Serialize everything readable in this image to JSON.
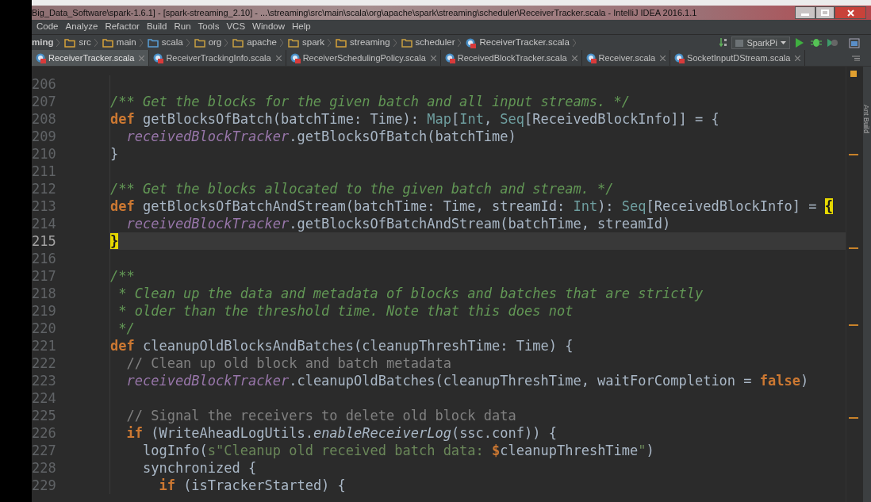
{
  "window": {
    "title": "Big_Data_Software\\spark-1.6.1] - [spark-streaming_2.10] - ...\\streaming\\src\\main\\scala\\org\\apache\\spark\\streaming\\scheduler\\ReceiverTracker.scala - IntelliJ IDEA 2016.1.1"
  },
  "menu": [
    "Code",
    "Analyze",
    "Refactor",
    "Build",
    "Run",
    "Tools",
    "VCS",
    "Window",
    "Help"
  ],
  "breadcrumbs": [
    {
      "label": "ming",
      "kind": "module"
    },
    {
      "label": "src",
      "kind": "folder"
    },
    {
      "label": "main",
      "kind": "folder"
    },
    {
      "label": "scala",
      "kind": "source"
    },
    {
      "label": "org",
      "kind": "package"
    },
    {
      "label": "apache",
      "kind": "package"
    },
    {
      "label": "spark",
      "kind": "package"
    },
    {
      "label": "streaming",
      "kind": "folder"
    },
    {
      "label": "scheduler",
      "kind": "package"
    },
    {
      "label": "ReceiverTracker.scala",
      "kind": "file"
    }
  ],
  "run_config": "SparkPi",
  "tabs": [
    {
      "label": "ReceiverTracker.scala",
      "selected": true
    },
    {
      "label": "ReceiverTrackingInfo.scala",
      "selected": false
    },
    {
      "label": "ReceiverSchedulingPolicy.scala",
      "selected": false
    },
    {
      "label": "ReceivedBlockTracker.scala",
      "selected": false
    },
    {
      "label": "Receiver.scala",
      "selected": false
    },
    {
      "label": "SocketInputDStream.scala",
      "selected": false
    }
  ],
  "side_tab": "Ant Build",
  "editor": {
    "lines": [
      {
        "number": "206",
        "current": false
      },
      {
        "number": "207",
        "current": false,
        "tokens": [
          {
            "kind": "doc",
            "text": "/** Get the blocks for the given batch and all input streams. */"
          }
        ]
      },
      {
        "number": "208",
        "current": false,
        "tokens": [
          {
            "kind": "kw",
            "text": "def "
          },
          {
            "kind": "plain",
            "text": "getBlocksOfBatch(batchTime: Time): "
          },
          {
            "kind": "type",
            "text": "Map"
          },
          {
            "kind": "plain",
            "text": "["
          },
          {
            "kind": "type",
            "text": "Int"
          },
          {
            "kind": "plain",
            "text": ", "
          },
          {
            "kind": "type",
            "text": "Seq"
          },
          {
            "kind": "plain",
            "text": "[ReceivedBlockInfo]] = {"
          }
        ]
      },
      {
        "number": "209",
        "current": false,
        "tokens": [
          {
            "kind": "field",
            "text": "  receivedBlockTracker"
          },
          {
            "kind": "plain",
            "text": ".getBlocksOfBatch(batchTime)"
          }
        ]
      },
      {
        "number": "210",
        "current": false,
        "tokens": [
          {
            "kind": "plain",
            "text": "}"
          }
        ]
      },
      {
        "number": "211",
        "current": false
      },
      {
        "number": "212",
        "current": false,
        "tokens": [
          {
            "kind": "doc",
            "text": "/** Get the blocks allocated to the given batch and stream. */"
          }
        ]
      },
      {
        "number": "213",
        "current": false,
        "tokens": [
          {
            "kind": "kw",
            "text": "def "
          },
          {
            "kind": "plain",
            "text": "getBlocksOfBatchAndStream(batchTime: Time, streamId: "
          },
          {
            "kind": "type",
            "text": "Int"
          },
          {
            "kind": "plain",
            "text": "): "
          },
          {
            "kind": "type",
            "text": "Seq"
          },
          {
            "kind": "plain",
            "text": "[ReceivedBlockInfo] = "
          },
          {
            "kind": "brace",
            "text": "{"
          }
        ]
      },
      {
        "number": "214",
        "current": false,
        "tokens": [
          {
            "kind": "field",
            "text": "  receivedBlockTracker"
          },
          {
            "kind": "plain",
            "text": ".getBlocksOfBatchAndStream(batchTime, streamId)"
          }
        ]
      },
      {
        "number": "215",
        "current": true,
        "tokens": [
          {
            "kind": "brace",
            "text": "}"
          }
        ]
      },
      {
        "number": "216",
        "current": false
      },
      {
        "number": "217",
        "current": false,
        "tokens": [
          {
            "kind": "doc",
            "text": "/**"
          }
        ]
      },
      {
        "number": "218",
        "current": false,
        "tokens": [
          {
            "kind": "doc",
            "text": " * Clean up the data and metadata of blocks and batches that are strictly"
          }
        ]
      },
      {
        "number": "219",
        "current": false,
        "tokens": [
          {
            "kind": "doc",
            "text": " * older than the threshold time. Note that this does not"
          }
        ]
      },
      {
        "number": "220",
        "current": false,
        "tokens": [
          {
            "kind": "doc",
            "text": " */"
          }
        ]
      },
      {
        "number": "221",
        "current": false,
        "tokens": [
          {
            "kind": "kw",
            "text": "def "
          },
          {
            "kind": "plain",
            "text": "cleanupOldBlocksAndBatches(cleanupThreshTime: Time) {"
          }
        ]
      },
      {
        "number": "222",
        "current": false,
        "tokens": [
          {
            "kind": "comment",
            "text": "  // Clean up old block and batch metadata"
          }
        ]
      },
      {
        "number": "223",
        "current": false,
        "tokens": [
          {
            "kind": "field",
            "text": "  receivedBlockTracker"
          },
          {
            "kind": "plain",
            "text": ".cleanupOldBatches(cleanupThreshTime, waitForCompletion = "
          },
          {
            "kind": "kw",
            "text": "false"
          },
          {
            "kind": "plain",
            "text": ")"
          }
        ]
      },
      {
        "number": "224",
        "current": false
      },
      {
        "number": "225",
        "current": false,
        "tokens": [
          {
            "kind": "comment",
            "text": "  // Signal the receivers to delete old block data"
          }
        ]
      },
      {
        "number": "226",
        "current": false,
        "tokens": [
          {
            "kind": "kw",
            "text": "  if "
          },
          {
            "kind": "plain",
            "text": "(WriteAheadLogUtils."
          },
          {
            "kind": "static",
            "text": "enableReceiverLog"
          },
          {
            "kind": "plain",
            "text": "(ssc.conf)) {"
          }
        ]
      },
      {
        "number": "227",
        "current": false,
        "tokens": [
          {
            "kind": "plain",
            "text": "    logInfo("
          },
          {
            "kind": "string",
            "text": "s\"Cleanup old received batch data: "
          },
          {
            "kind": "kw",
            "text": "$"
          },
          {
            "kind": "plain",
            "text": "cleanupThreshTime"
          },
          {
            "kind": "string",
            "text": "\""
          },
          {
            "kind": "plain",
            "text": ")"
          }
        ]
      },
      {
        "number": "228",
        "current": false,
        "tokens": [
          {
            "kind": "plain",
            "text": "    synchronized {"
          }
        ]
      },
      {
        "number": "229",
        "current": false,
        "tokens": [
          {
            "kind": "kw",
            "text": "      if "
          },
          {
            "kind": "plain",
            "text": "(isTrackerStarted) {"
          }
        ]
      }
    ]
  }
}
